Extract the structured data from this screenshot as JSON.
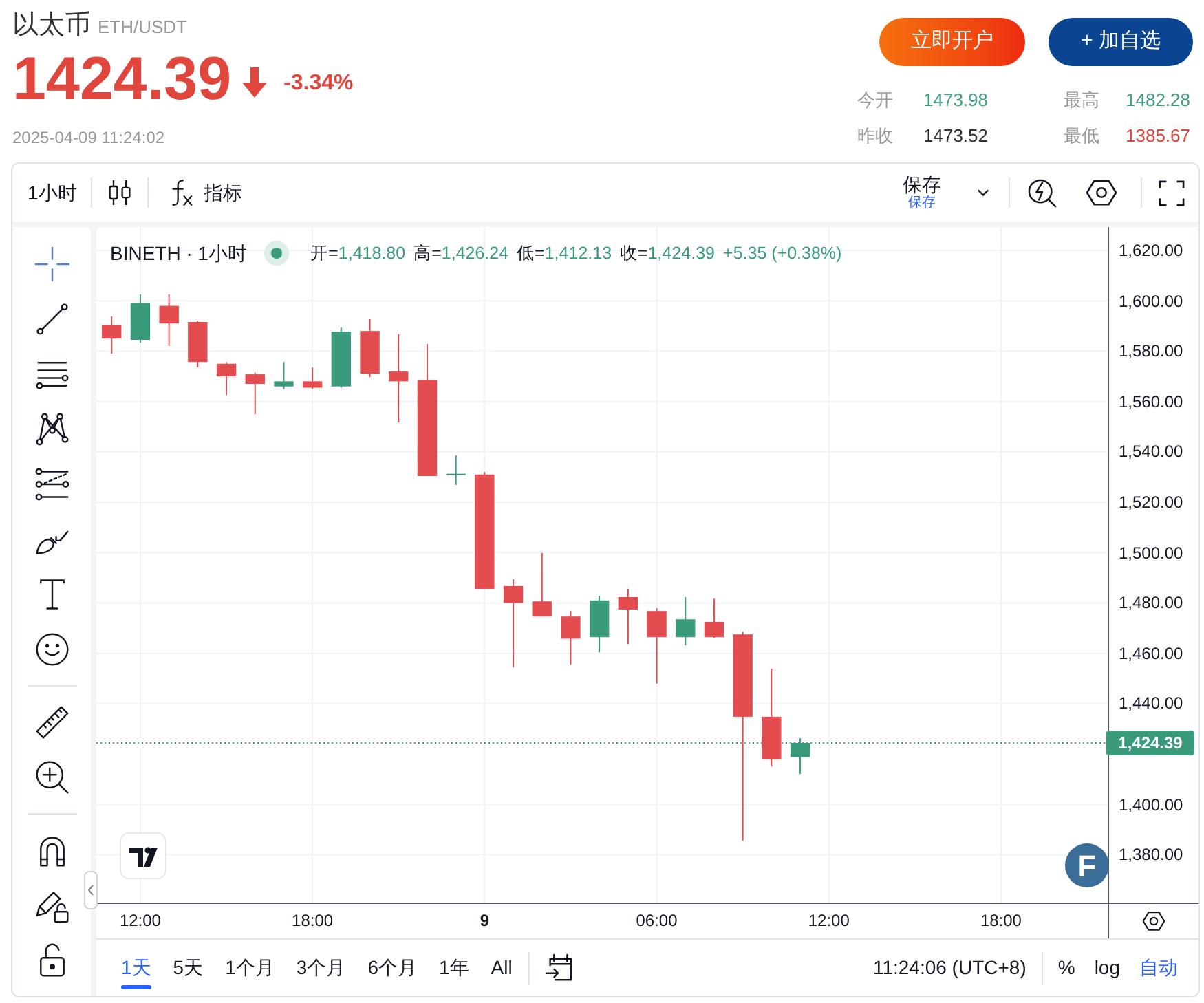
{
  "header": {
    "name": "以太币",
    "symbol": "ETH/USDT",
    "price": "1424.39",
    "falling": true,
    "change": "-3.34%",
    "timestamp": "2025-04-09 11:24:02"
  },
  "actions": [
    {
      "label": "立即开户",
      "kind": "primary"
    },
    {
      "label": "+ 加自选",
      "kind": "secondary"
    }
  ],
  "stats": [
    {
      "label": "今开",
      "value": "1473.98",
      "color": "#3fa07c"
    },
    {
      "label": "最高",
      "value": "1482.28",
      "color": "#3fa07c"
    },
    {
      "label": "昨收",
      "value": "1473.52",
      "color": "#333333"
    },
    {
      "label": "最低",
      "value": "1385.67",
      "color": "#e0463c"
    }
  ],
  "toolbar": {
    "interval": "1小时",
    "indicators": "指标",
    "save": "保存",
    "save_sub": "保存"
  },
  "drawing_tools": [
    {
      "tools": [
        {
          "kind": "crosshair",
          "selected": true
        },
        {
          "kind": "trend-line",
          "selected": false
        },
        {
          "kind": "horizontal-lines",
          "selected": false
        },
        {
          "kind": "pattern",
          "selected": false
        },
        {
          "kind": "fib",
          "selected": false
        },
        {
          "kind": "brush",
          "selected": false
        },
        {
          "kind": "text",
          "selected": false
        },
        {
          "kind": "smiley",
          "selected": false
        }
      ]
    },
    {
      "tools": [
        {
          "kind": "ruler",
          "selected": false
        },
        {
          "kind": "zoom-in",
          "selected": false
        }
      ]
    },
    {
      "tools": [
        {
          "kind": "magnet",
          "selected": false
        },
        {
          "kind": "pencil-lock",
          "selected": false
        },
        {
          "kind": "lock",
          "selected": false
        }
      ]
    }
  ],
  "legend": {
    "title": "BINETH · 1小时",
    "fields": [
      {
        "label": "开=",
        "value": "1,418.80"
      },
      {
        "label": "高=",
        "value": "1,426.24"
      },
      {
        "label": "低=",
        "value": "1,412.13"
      },
      {
        "label": "收=",
        "value": "1,424.39"
      }
    ],
    "change": "+5.35 (+0.38%)"
  },
  "chart": {
    "badge": "F",
    "chart_data": {
      "type": "candlestick",
      "grid": true,
      "x": [
        "2025-04-08 11:00",
        "2025-04-08 12:00",
        "2025-04-08 13:00",
        "2025-04-08 14:00",
        "2025-04-08 15:00",
        "2025-04-08 16:00",
        "2025-04-08 17:00",
        "2025-04-08 18:00",
        "2025-04-08 19:00",
        "2025-04-08 20:00",
        "2025-04-08 21:00",
        "2025-04-08 22:00",
        "2025-04-08 23:00",
        "2025-04-09 00:00",
        "2025-04-09 01:00",
        "2025-04-09 02:00",
        "2025-04-09 03:00",
        "2025-04-09 04:00",
        "2025-04-09 05:00",
        "2025-04-09 06:00",
        "2025-04-09 07:00",
        "2025-04-09 08:00",
        "2025-04-09 09:00",
        "2025-04-09 10:00",
        "2025-04-09 11:00"
      ],
      "xlim": [
        "2025-04-08 10:28",
        "2025-04-10 00:53"
      ],
      "ylim": [
        1361,
        1629.3
      ],
      "xticks": [
        {
          "value": "2025-04-08 12:00",
          "label": "12:00"
        },
        {
          "value": "2025-04-08 18:00",
          "label": "18:00"
        },
        {
          "value": "2025-04-09 00:00",
          "label": "9"
        },
        {
          "value": "2025-04-09 06:00",
          "label": "06:00"
        },
        {
          "value": "2025-04-09 12:00",
          "label": "12:00"
        },
        {
          "value": "2025-04-09 18:00",
          "label": "18:00"
        }
      ],
      "yticks": [
        {
          "value": 1620,
          "label": "1,620.00"
        },
        {
          "value": 1600,
          "label": "1,600.00"
        },
        {
          "value": 1580,
          "label": "1,580.00"
        },
        {
          "value": 1560,
          "label": "1,560.00"
        },
        {
          "value": 1540,
          "label": "1,540.00"
        },
        {
          "value": 1520,
          "label": "1,520.00"
        },
        {
          "value": 1500,
          "label": "1,500.00"
        },
        {
          "value": 1480,
          "label": "1,480.00"
        },
        {
          "value": 1460,
          "label": "1,460.00"
        },
        {
          "value": 1440,
          "label": "1,440.00"
        },
        {
          "value": 1400,
          "label": "1,400.00"
        },
        {
          "value": 1380,
          "label": "1,380.00"
        }
      ],
      "ohlc": [
        [
          1590.5,
          1593.8,
          1579,
          1585
        ],
        [
          1584.5,
          1602.5,
          1583.4,
          1599.2
        ],
        [
          1598,
          1602.5,
          1582,
          1591
        ],
        [
          1591.6,
          1592,
          1573.6,
          1575.7
        ],
        [
          1575,
          1575.7,
          1562.6,
          1570
        ],
        [
          1570.8,
          1571.5,
          1555,
          1567
        ],
        [
          1566,
          1575.7,
          1565,
          1568
        ],
        [
          1568,
          1573.5,
          1565,
          1565.5
        ],
        [
          1566,
          1589.4,
          1565.5,
          1587.7
        ],
        [
          1588,
          1592.7,
          1569.7,
          1571
        ],
        [
          1571.9,
          1586.7,
          1551.7,
          1568
        ],
        [
          1568.6,
          1582.8,
          1530.4,
          1530.4
        ],
        [
          1530.9,
          1538.6,
          1526.9,
          1531.3
        ],
        [
          1531,
          1532,
          1485.6,
          1485.6
        ],
        [
          1486.7,
          1489.4,
          1454.4,
          1480
        ],
        [
          1480.6,
          1499.8,
          1474.6,
          1474.6
        ],
        [
          1474.6,
          1476.8,
          1455.5,
          1465.8
        ],
        [
          1466.4,
          1482.8,
          1460.4,
          1481
        ],
        [
          1482.3,
          1485.6,
          1463.7,
          1477.4
        ],
        [
          1476.8,
          1477.9,
          1447.9,
          1466.4
        ],
        [
          1466.4,
          1482.3,
          1463.2,
          1473.5
        ],
        [
          1472.5,
          1481.7,
          1466,
          1466.4
        ],
        [
          1467.5,
          1468.6,
          1385.6,
          1434.8
        ],
        [
          1434.8,
          1453.9,
          1415,
          1417.8
        ],
        [
          1418.8,
          1426.2,
          1412.1,
          1424.4
        ]
      ],
      "ref_lines": [
        {
          "axis": "y",
          "value": 1424.39,
          "label": "1,424.39"
        }
      ]
    }
  },
  "range_bar": {
    "ranges": [
      {
        "label": "1天",
        "selected": true
      },
      {
        "label": "5天",
        "selected": false
      },
      {
        "label": "1个月",
        "selected": false
      },
      {
        "label": "3个月",
        "selected": false
      },
      {
        "label": "6个月",
        "selected": false
      },
      {
        "label": "1年",
        "selected": false
      },
      {
        "label": "All",
        "selected": false
      }
    ],
    "clock": "11:24:06 (UTC+8)",
    "scale_options": [
      {
        "label": "%",
        "selected": false
      },
      {
        "label": "log",
        "selected": false
      },
      {
        "label": "自动",
        "selected": true
      }
    ]
  }
}
